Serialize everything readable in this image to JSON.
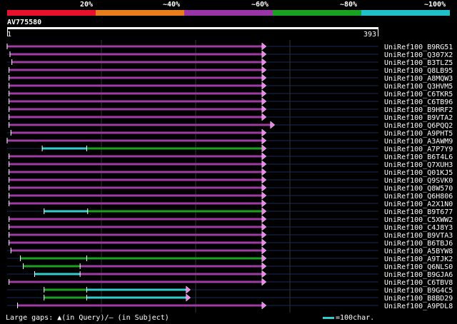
{
  "legend": {
    "colors": [
      "#e8112d",
      "#e87d1e",
      "#9a35a8",
      "#1aa122",
      "#20c0c8"
    ],
    "labels": [
      "20%",
      "~40%",
      "~60%",
      "~80%",
      "~100%"
    ]
  },
  "query": {
    "name": "AV775580",
    "start": "1",
    "end": "393",
    "length": 393
  },
  "colors": {
    "magenta": "#a03aa5",
    "green": "#1aa122",
    "cyan": "#33cccc",
    "dark_line": "#1a2a5a",
    "dark_gap": "#202060",
    "guide": "#333333",
    "arrow_fill": "#f080f0"
  },
  "hits": [
    {
      "name": "UniRef100_B9RG51",
      "segments": [
        {
          "s": 1,
          "e": 270,
          "c": "magenta"
        }
      ]
    },
    {
      "name": "UniRef100_Q307X2",
      "segments": [
        {
          "s": 4,
          "e": 270,
          "c": "magenta"
        }
      ]
    },
    {
      "name": "UniRef100_B3TLZ5",
      "segments": [
        {
          "s": 6,
          "e": 270,
          "c": "magenta"
        }
      ]
    },
    {
      "name": "UniRef100_Q8LB95",
      "segments": [
        {
          "s": 3,
          "e": 270,
          "c": "magenta"
        }
      ]
    },
    {
      "name": "UniRef100_A8MQW3",
      "segments": [
        {
          "s": 3,
          "e": 270,
          "c": "magenta"
        }
      ]
    },
    {
      "name": "UniRef100_Q3HVM5",
      "segments": [
        {
          "s": 3,
          "e": 270,
          "c": "magenta"
        }
      ]
    },
    {
      "name": "UniRef100_C6TKR5",
      "segments": [
        {
          "s": 3,
          "e": 270,
          "c": "magenta"
        }
      ]
    },
    {
      "name": "UniRef100_C6TB96",
      "segments": [
        {
          "s": 3,
          "e": 270,
          "c": "magenta"
        }
      ]
    },
    {
      "name": "UniRef100_B9HRF2",
      "segments": [
        {
          "s": 3,
          "e": 270,
          "c": "magenta"
        }
      ]
    },
    {
      "name": "UniRef100_B9VTA2",
      "segments": [
        {
          "s": 3,
          "e": 270,
          "c": "magenta"
        }
      ]
    },
    {
      "name": "UniRef100_Q6PQQ2",
      "segments": [
        {
          "s": 3,
          "e": 279,
          "c": "magenta"
        }
      ]
    },
    {
      "name": "UniRef100_A9PHT5",
      "segments": [
        {
          "s": 5,
          "e": 270,
          "c": "magenta"
        }
      ]
    },
    {
      "name": "UniRef100_A3AWM9",
      "segments": [
        {
          "s": 1,
          "e": 270,
          "c": "magenta"
        }
      ]
    },
    {
      "name": "UniRef100_A7P7Y9",
      "segments": [
        {
          "s": 38,
          "e": 85,
          "c": "cyan"
        },
        {
          "s": 85,
          "e": 270,
          "c": "green"
        }
      ]
    },
    {
      "name": "UniRef100_B6T4L6",
      "segments": [
        {
          "s": 3,
          "e": 270,
          "c": "magenta"
        }
      ]
    },
    {
      "name": "UniRef100_Q7XUH3",
      "segments": [
        {
          "s": 3,
          "e": 270,
          "c": "magenta"
        }
      ]
    },
    {
      "name": "UniRef100_Q01KJ5",
      "segments": [
        {
          "s": 3,
          "e": 270,
          "c": "magenta"
        }
      ]
    },
    {
      "name": "UniRef100_Q9SVK0",
      "segments": [
        {
          "s": 3,
          "e": 270,
          "c": "magenta"
        }
      ]
    },
    {
      "name": "UniRef100_Q8W570",
      "segments": [
        {
          "s": 3,
          "e": 270,
          "c": "magenta"
        }
      ]
    },
    {
      "name": "UniRef100_Q6H806",
      "segments": [
        {
          "s": 3,
          "e": 270,
          "c": "magenta"
        }
      ]
    },
    {
      "name": "UniRef100_A2X1N0",
      "segments": [
        {
          "s": 3,
          "e": 270,
          "c": "magenta"
        }
      ]
    },
    {
      "name": "UniRef100_B9T677",
      "segments": [
        {
          "s": 40,
          "e": 86,
          "c": "cyan"
        },
        {
          "s": 86,
          "e": 270,
          "c": "green"
        }
      ]
    },
    {
      "name": "UniRef100_C5XWW2",
      "segments": [
        {
          "s": 3,
          "e": 270,
          "c": "magenta"
        }
      ]
    },
    {
      "name": "UniRef100_C4J8Y3",
      "segments": [
        {
          "s": 3,
          "e": 270,
          "c": "magenta"
        }
      ]
    },
    {
      "name": "UniRef100_B9VTA3",
      "segments": [
        {
          "s": 3,
          "e": 270,
          "c": "magenta"
        }
      ]
    },
    {
      "name": "UniRef100_B6TBJ6",
      "segments": [
        {
          "s": 3,
          "e": 270,
          "c": "magenta"
        }
      ]
    },
    {
      "name": "UniRef100_A5BYW8",
      "segments": [
        {
          "s": 5,
          "e": 270,
          "c": "magenta"
        }
      ]
    },
    {
      "name": "UniRef100_A9TJK2",
      "segments": [
        {
          "s": 15,
          "e": 85,
          "c": "green"
        },
        {
          "s": 85,
          "e": 270,
          "c": "green"
        }
      ]
    },
    {
      "name": "UniRef100_Q6NLS0",
      "segments": [
        {
          "s": 18,
          "e": 78,
          "c": "green"
        },
        {
          "s": 78,
          "e": 270,
          "c": "magenta"
        }
      ]
    },
    {
      "name": "UniRef100_B9GJA6",
      "segments": [
        {
          "s": 30,
          "e": 78,
          "c": "cyan"
        },
        {
          "s": 78,
          "e": 270,
          "c": "magenta"
        }
      ]
    },
    {
      "name": "UniRef100_C6TBV8",
      "segments": [
        {
          "s": 3,
          "e": 270,
          "c": "magenta"
        }
      ]
    },
    {
      "name": "UniRef100_B9G4C5",
      "segments": [
        {
          "s": 40,
          "e": 85,
          "c": "green"
        },
        {
          "s": 85,
          "e": 190,
          "c": "cyan"
        }
      ]
    },
    {
      "name": "UniRef100_B8BD29",
      "segments": [
        {
          "s": 40,
          "e": 85,
          "c": "green"
        },
        {
          "s": 85,
          "e": 190,
          "c": "cyan"
        }
      ]
    },
    {
      "name": "UniRef100_A9PDL8",
      "segments": [
        {
          "s": 12,
          "e": 270,
          "c": "magenta"
        }
      ]
    }
  ],
  "footer": {
    "text": "Large gaps: ▲(in Query)/– (in Subject)",
    "scale": "=100char."
  }
}
